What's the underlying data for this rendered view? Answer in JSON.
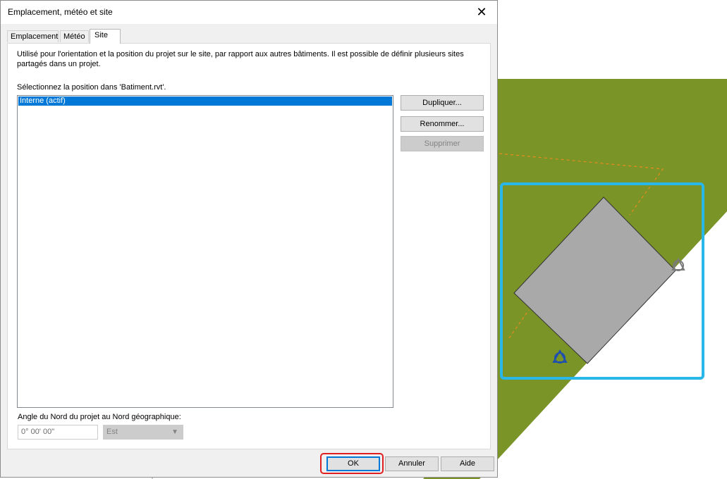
{
  "dialog": {
    "title": "Emplacement, météo et site",
    "close_glyph": "✕",
    "tabs": [
      {
        "label": "Emplacement",
        "active": false
      },
      {
        "label": "Météo",
        "active": false
      },
      {
        "label": "Site",
        "active": true
      }
    ],
    "description": "Utilisé pour l'orientation et la position du projet sur le site, par rapport aux autres bâtiments. Il est possible de définir plusieurs sites partagés dans un projet.",
    "select_label": "Sélectionnez la position dans 'Batiment.rvt'.",
    "positions": [
      "Interne (actif)"
    ],
    "side_buttons": {
      "duplicate": "Dupliquer...",
      "rename": "Renommer...",
      "delete": "Supprimer"
    },
    "angle_label": "Angle du Nord du projet au Nord géographique:",
    "angle_value": "0° 00' 00\"",
    "direction_value": "Est",
    "footer": {
      "ok": "OK",
      "cancel": "Annuler",
      "help": "Aide"
    }
  },
  "background": {
    "site_color": "#7a9428",
    "building_color": "#a9a9a9",
    "selection_color": "#29b6e8",
    "marker_color": "#1e4fb0"
  }
}
